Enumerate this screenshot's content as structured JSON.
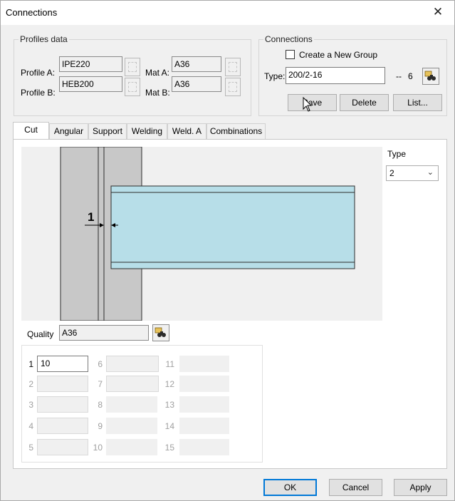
{
  "window": {
    "title": "Connections",
    "close_glyph": "✕"
  },
  "profiles": {
    "legend": "Profiles data",
    "profile_a_label": "Profile A:",
    "profile_a_value": "IPE220",
    "profile_b_label": "Profile B:",
    "profile_b_value": "HEB200",
    "mat_a_label": "Mat A:",
    "mat_a_value": "A36",
    "mat_b_label": "Mat B:",
    "mat_b_value": "A36"
  },
  "connections": {
    "legend": "Connections",
    "create_group_label": "Create a New Group",
    "create_group_checked": false,
    "type_label": "Type:",
    "type_value": "200/2-16",
    "separator": "--",
    "count": "6",
    "save_label": "Save",
    "delete_label": "Delete",
    "list_label": "List..."
  },
  "tabs": [
    {
      "label": "Cut",
      "active": true
    },
    {
      "label": "Angular",
      "active": false
    },
    {
      "label": "Support",
      "active": false
    },
    {
      "label": "Welding",
      "active": false
    },
    {
      "label": "Weld. A",
      "active": false
    },
    {
      "label": "Combinations",
      "active": false
    }
  ],
  "cut": {
    "dimension_label": "1",
    "type_label": "Type",
    "type_value": "2",
    "quality_label": "Quality",
    "quality_value": "A36",
    "grid": [
      {
        "num": "1",
        "value": "10"
      },
      {
        "num": "2",
        "value": ""
      },
      {
        "num": "3",
        "value": ""
      },
      {
        "num": "4",
        "value": ""
      },
      {
        "num": "5",
        "value": ""
      },
      {
        "num": "6",
        "value": ""
      },
      {
        "num": "7",
        "value": ""
      },
      {
        "num": "8",
        "value": ""
      },
      {
        "num": "9",
        "value": ""
      },
      {
        "num": "10",
        "value": ""
      },
      {
        "num": "11",
        "value": ""
      },
      {
        "num": "12",
        "value": ""
      },
      {
        "num": "13",
        "value": ""
      },
      {
        "num": "14",
        "value": ""
      },
      {
        "num": "15",
        "value": ""
      }
    ]
  },
  "footer": {
    "ok_label": "OK",
    "cancel_label": "Cancel",
    "apply_label": "Apply"
  },
  "colors": {
    "beam_fill": "#b7dee8",
    "column_fill": "#c8c8c8",
    "accent": "#0078d7"
  }
}
